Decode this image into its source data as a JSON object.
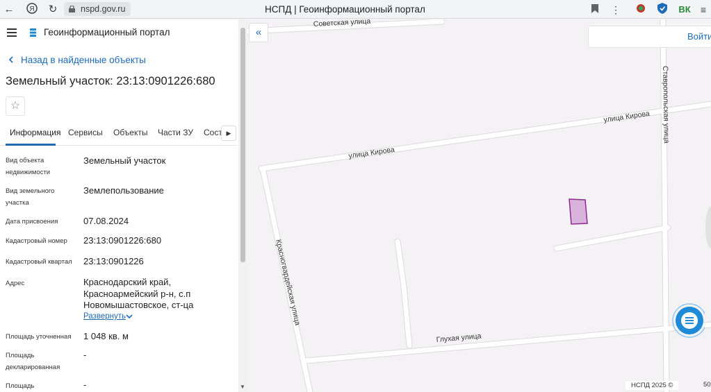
{
  "browser": {
    "url": "nspd.gov.ru",
    "tab_title": "НСПД | Геоинформационный портал",
    "ext_vk": "ВК"
  },
  "header": {
    "portal_name": "Геоинформационный портал"
  },
  "nav": {
    "back_label": "Назад в найденные объекты"
  },
  "object": {
    "title": "Земельный участок: 23:13:0901226:680"
  },
  "tabs": [
    {
      "label": "Информация"
    },
    {
      "label": "Сервисы"
    },
    {
      "label": "Объекты"
    },
    {
      "label": "Части ЗУ"
    },
    {
      "label": "Соста"
    }
  ],
  "info": {
    "rows": [
      {
        "label": "Вид объекта недвижимости",
        "value": "Земельный участок"
      },
      {
        "label": "Вид земельного участка",
        "value": "Землепользование"
      },
      {
        "label": "Дата присвоения",
        "value": "07.08.2024"
      },
      {
        "label": "Кадастровый номер",
        "value": "23:13:0901226:680"
      },
      {
        "label": "Кадастровый квартал",
        "value": "23:13:0901226"
      },
      {
        "label": "Адрес",
        "value": "Краснодарский край, Красноармейский р-н, с.п Новомышастовское, ст-ца"
      },
      {
        "label": "Площадь уточненная",
        "value": "1 048 кв. м"
      },
      {
        "label": "Площадь декларированная",
        "value": "-"
      },
      {
        "label": "Площадь",
        "value": "-"
      }
    ],
    "expand_label": "Развернуть"
  },
  "map": {
    "streets": {
      "sovetskaya": "Советская улица",
      "kirova_1": "улица Кирова",
      "kirova_2": "улица Кирова",
      "stavropolskaya": "Ставропольская улица",
      "krasnogvardeyskaya": "Красногвардейская улица",
      "glukhaya": "Глухая улица"
    },
    "login_label": "Войти",
    "footer": "НСПД 2025 ©",
    "scale_fragment": "50",
    "colors": {
      "parcel_fill": "#d9b3dc",
      "parcel_stroke": "#8e2a92",
      "road": "#ffffff",
      "accent": "#1f6bb5"
    }
  }
}
